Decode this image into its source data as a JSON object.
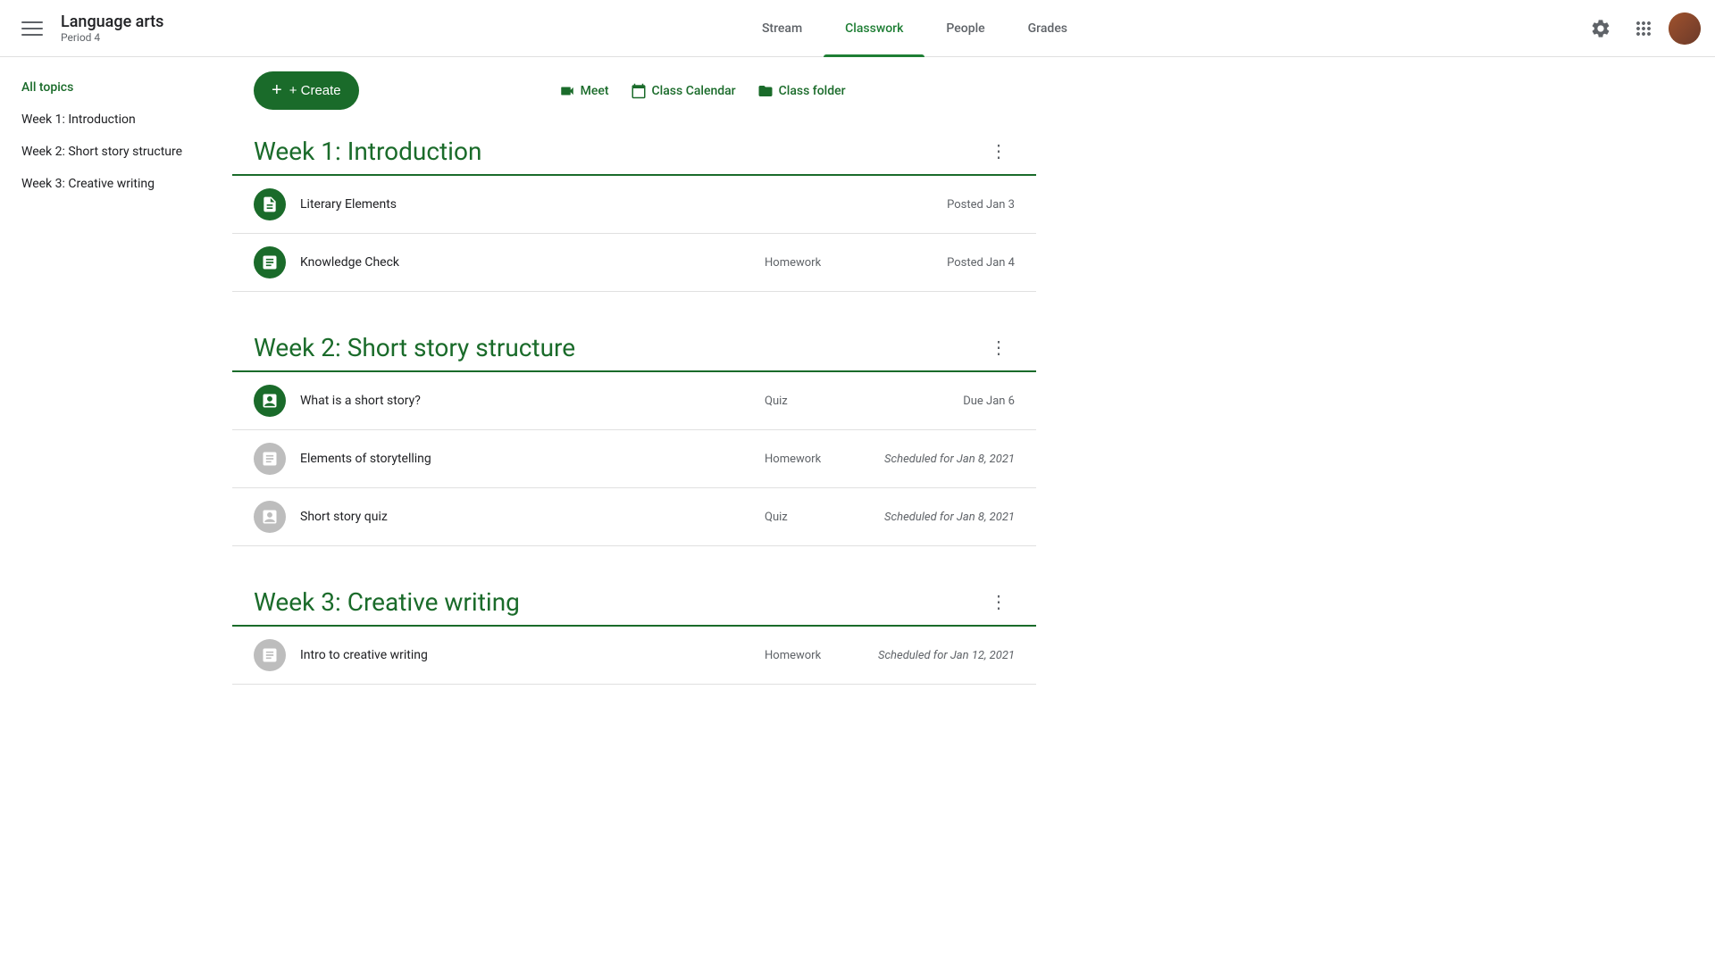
{
  "app": {
    "title": "Language arts",
    "subtitle": "Period 4"
  },
  "nav": {
    "items": [
      {
        "id": "stream",
        "label": "Stream",
        "active": false
      },
      {
        "id": "classwork",
        "label": "Classwork",
        "active": true
      },
      {
        "id": "people",
        "label": "People",
        "active": false
      },
      {
        "id": "grades",
        "label": "Grades",
        "active": false
      }
    ]
  },
  "toolbar": {
    "create_label": "+ Create",
    "meet_label": "Meet",
    "calendar_label": "Class Calendar",
    "folder_label": "Class folder"
  },
  "sidebar": {
    "items": [
      {
        "id": "all-topics",
        "label": "All topics",
        "active": true
      },
      {
        "id": "week1",
        "label": "Week 1: Introduction",
        "active": false
      },
      {
        "id": "week2",
        "label": "Week 2: Short story structure",
        "active": false
      },
      {
        "id": "week3",
        "label": "Week 3: Creative writing",
        "active": false
      }
    ]
  },
  "sections": [
    {
      "id": "week1",
      "title": "Week 1: Introduction",
      "assignments": [
        {
          "id": "literary-elements",
          "name": "Literary Elements",
          "type": "",
          "date": "Posted Jan 3",
          "icon_type": "material",
          "scheduled": false
        },
        {
          "id": "knowledge-check",
          "name": "Knowledge Check",
          "type": "Homework",
          "date": "Posted Jan 4",
          "icon_type": "assignment",
          "scheduled": false
        }
      ]
    },
    {
      "id": "week2",
      "title": "Week 2: Short story structure",
      "assignments": [
        {
          "id": "what-is-short-story",
          "name": "What is a short story?",
          "type": "Quiz",
          "date": "Due Jan 6",
          "icon_type": "quiz",
          "scheduled": false
        },
        {
          "id": "elements-storytelling",
          "name": "Elements of storytelling",
          "type": "Homework",
          "date": "Scheduled for Jan 8, 2021",
          "icon_type": "gray",
          "scheduled": true
        },
        {
          "id": "short-story-quiz",
          "name": "Short story quiz",
          "type": "Quiz",
          "date": "Scheduled for Jan 8, 2021",
          "icon_type": "gray",
          "scheduled": true
        }
      ]
    },
    {
      "id": "week3",
      "title": "Week 3: Creative writing",
      "assignments": [
        {
          "id": "intro-creative-writing",
          "name": "Intro to creative writing",
          "type": "Homework",
          "date": "Scheduled for Jan 12, 2021",
          "icon_type": "gray",
          "scheduled": true
        }
      ]
    }
  ]
}
